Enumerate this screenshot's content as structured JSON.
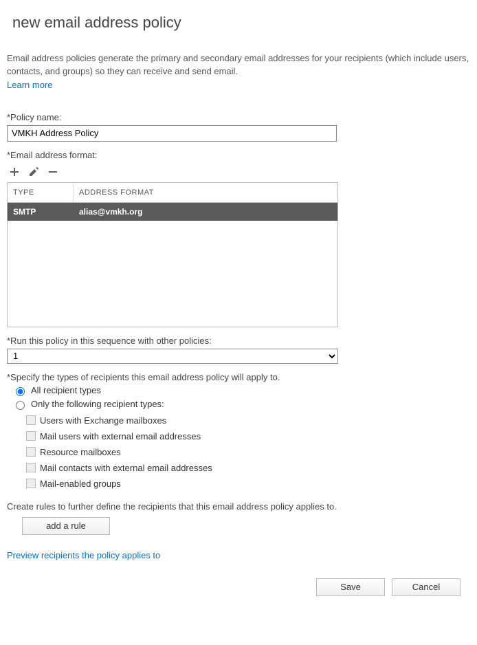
{
  "page_title": "new email address policy",
  "description": "Email address policies generate the primary and secondary email addresses for your recipients (which include users, contacts, and groups) so they can receive and send email.",
  "learn_more": "Learn more",
  "policy_name": {
    "label": "*Policy name:",
    "value": "VMKH Address Policy"
  },
  "email_format": {
    "label": "*Email address format:",
    "columns": {
      "type": "TYPE",
      "format": "ADDRESS FORMAT"
    },
    "rows": [
      {
        "type": "SMTP",
        "format": "alias@vmkh.org",
        "selected": true
      }
    ]
  },
  "sequence": {
    "label": "*Run this policy in this sequence with other policies:",
    "value": "1"
  },
  "scope": {
    "label": "*Specify the types of recipients this email address policy will apply to.",
    "options": {
      "all": "All recipient types",
      "only": "Only the following recipient types:"
    },
    "sub_checks": [
      "Users with Exchange mailboxes",
      "Mail users with external email addresses",
      "Resource mailboxes",
      "Mail contacts with external email addresses",
      "Mail-enabled groups"
    ]
  },
  "rules_text": "Create rules to further define the recipients that this email address policy applies to.",
  "add_rule": "add a rule",
  "preview_link": "Preview recipients the policy applies to",
  "buttons": {
    "save": "Save",
    "cancel": "Cancel"
  }
}
